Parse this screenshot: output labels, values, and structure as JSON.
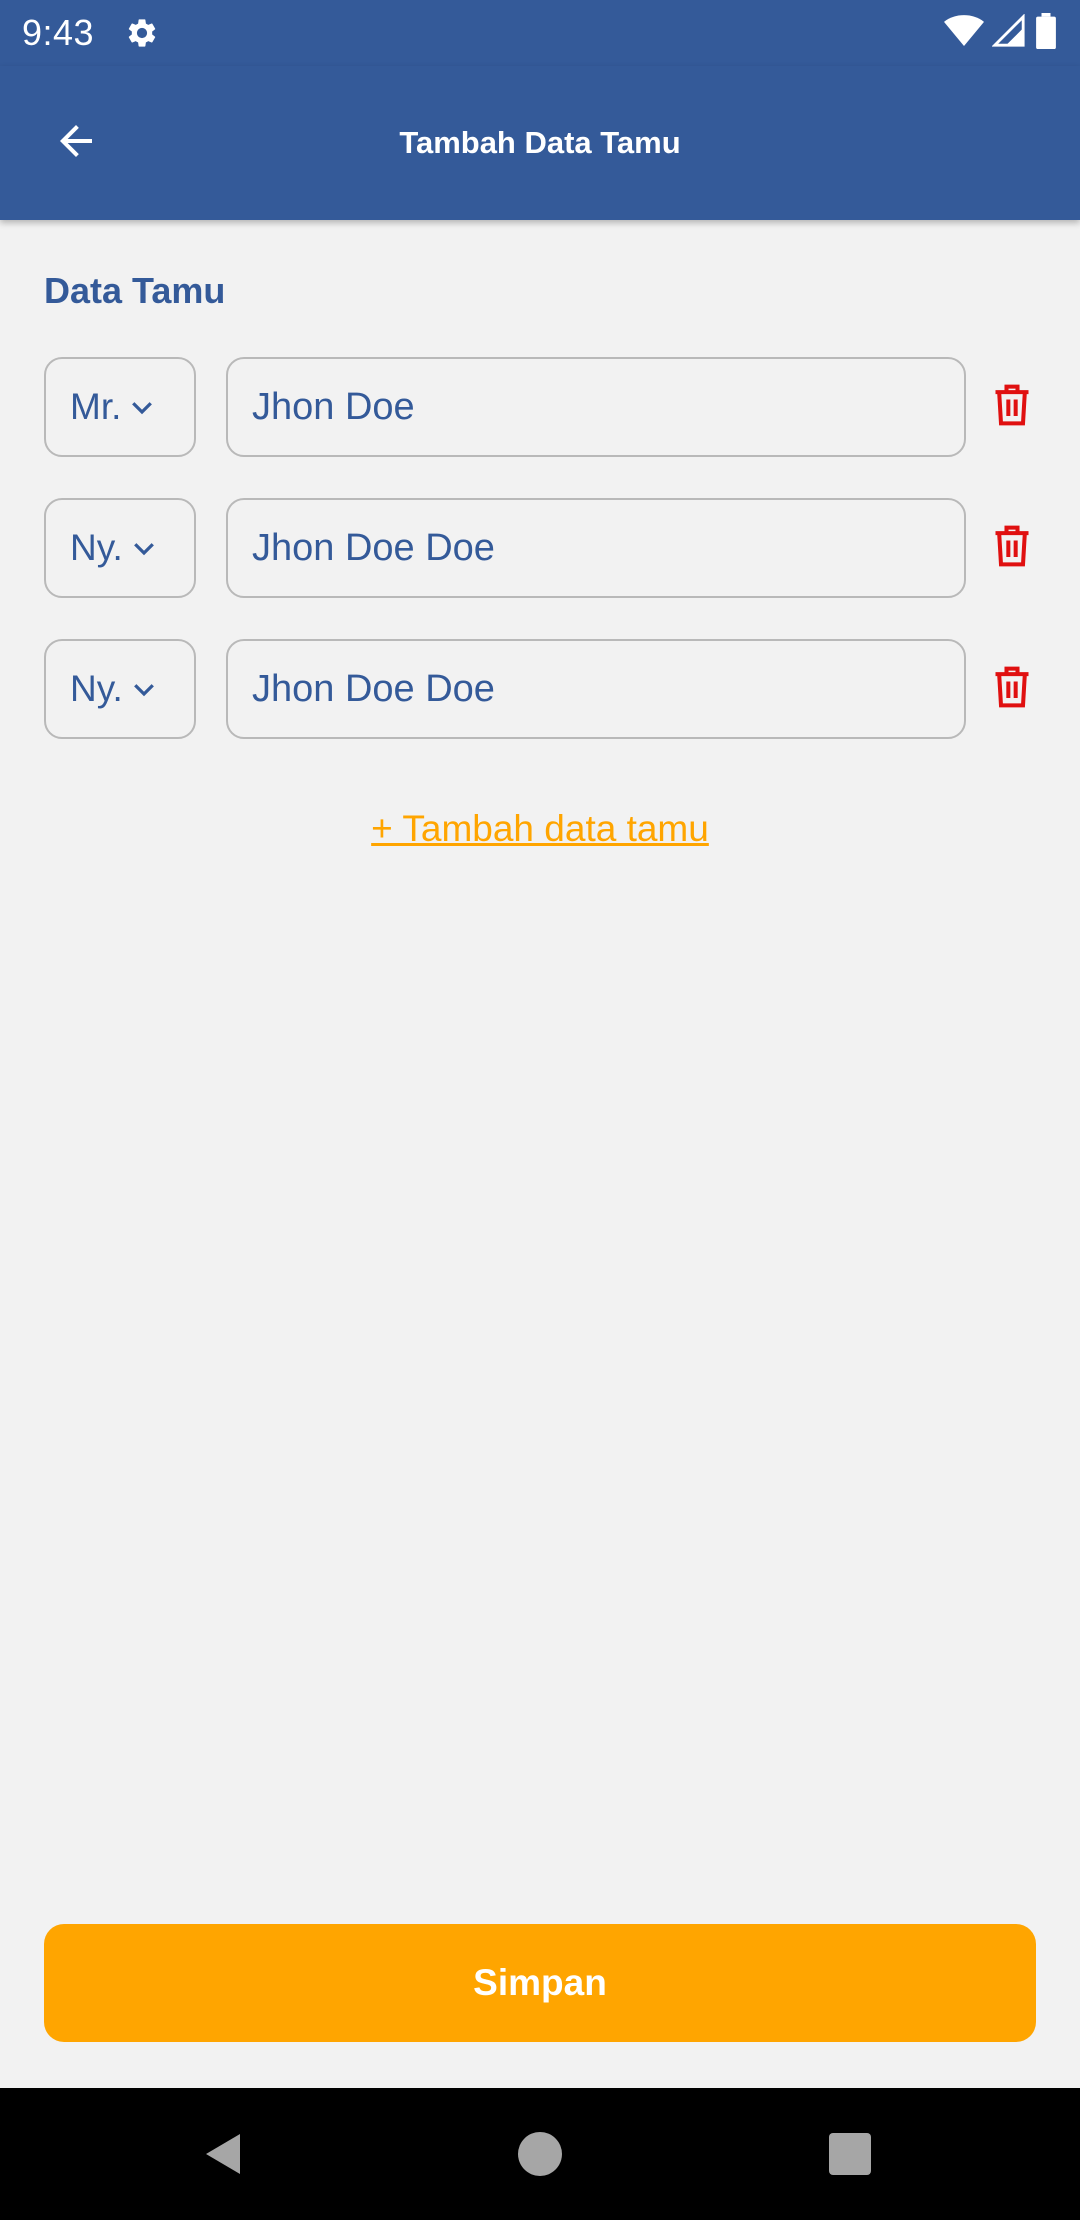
{
  "status_bar": {
    "time": "9:43",
    "settings_icon": "gear-icon",
    "wifi_icon": "wifi-icon",
    "signal_icon": "signal-icon",
    "battery_icon": "battery-icon"
  },
  "app_bar": {
    "title": "Tambah Data Tamu",
    "back_icon": "arrow-back-icon",
    "background_color": "#345a99"
  },
  "section": {
    "title": "Data Tamu"
  },
  "guests": [
    {
      "salutation": "Mr.",
      "name": "Jhon Doe"
    },
    {
      "salutation": "Ny.",
      "name": "Jhon Doe Doe"
    },
    {
      "salutation": "Ny.",
      "name": "Jhon Doe Doe"
    }
  ],
  "add_guest_link": "+ Tambah data tamu",
  "save_button": {
    "label": "Simpan",
    "color": "#ffa500"
  },
  "colors": {
    "primary": "#345a99",
    "accent": "#ffa500",
    "delete": "#e01010"
  },
  "nav_bar": {
    "back_icon": "triangle-back-icon",
    "home_icon": "circle-home-icon",
    "recent_icon": "square-recents-icon"
  }
}
